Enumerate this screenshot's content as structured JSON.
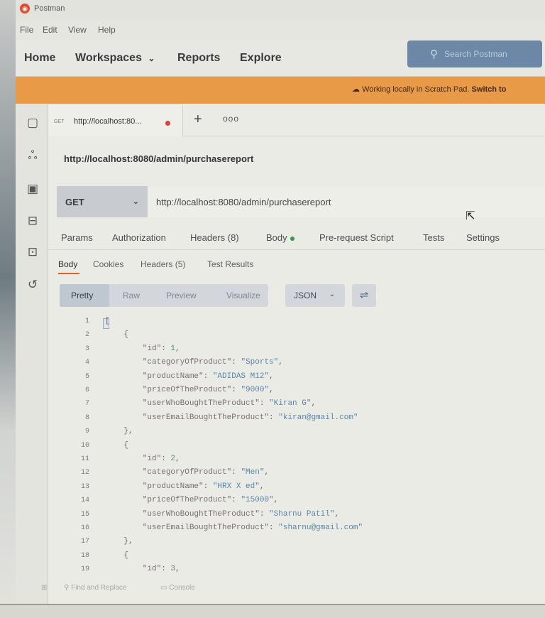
{
  "app": {
    "title": "Postman",
    "logo_glyph": "◉"
  },
  "menu": [
    "File",
    "Edit",
    "View",
    "Help"
  ],
  "nav": {
    "home": "Home",
    "workspaces": "Workspaces",
    "reports": "Reports",
    "explore": "Explore",
    "workspaces_chevron": "⌄"
  },
  "search": {
    "placeholder": "Search Postman",
    "icon": "search-icon"
  },
  "banner": {
    "icon": "cloud-off-icon",
    "text": "Working locally in Scratch Pad.",
    "link": "Switch to"
  },
  "sidebar_icons": [
    "collections-icon",
    "apis-icon",
    "environments-icon",
    "mock-servers-icon",
    "monitors-icon",
    "history-icon"
  ],
  "tab": {
    "method": "GET",
    "url": "http://localhost:80...",
    "add": "+",
    "more": "ooo"
  },
  "request": {
    "title": "http://localhost:8080/admin/purchasereport",
    "method": "GET",
    "url": "http://localhost:8080/admin/purchasereport"
  },
  "request_tabs": {
    "params": "Params",
    "authorization": "Authorization",
    "headers": "Headers (8)",
    "body": "Body",
    "prerequest": "Pre-request Script",
    "tests": "Tests",
    "settings": "Settings"
  },
  "response_tabs": {
    "body": "Body",
    "cookies": "Cookies",
    "headers": "Headers (5)",
    "test_results": "Test Results"
  },
  "format": {
    "pretty": "Pretty",
    "raw": "Raw",
    "preview": "Preview",
    "visualize": "Visualize",
    "language": "JSON"
  },
  "code_lines": [
    {
      "n": "1",
      "parts": [
        [
          "punc",
          "["
        ]
      ]
    },
    {
      "n": "2",
      "parts": [
        [
          "punc",
          "    {"
        ]
      ]
    },
    {
      "n": "3",
      "parts": [
        [
          "key",
          "        \"id\""
        ],
        [
          "punc",
          ": "
        ],
        [
          "num",
          "1"
        ],
        [
          "punc",
          ","
        ]
      ]
    },
    {
      "n": "4",
      "parts": [
        [
          "key",
          "        \"categoryOfProduct\""
        ],
        [
          "punc",
          ": "
        ],
        [
          "str",
          "\"Sports\""
        ],
        [
          "punc",
          ","
        ]
      ]
    },
    {
      "n": "5",
      "parts": [
        [
          "key",
          "        \"productName\""
        ],
        [
          "punc",
          ": "
        ],
        [
          "str",
          "\"ADIDAS M12\""
        ],
        [
          "punc",
          ","
        ]
      ]
    },
    {
      "n": "6",
      "parts": [
        [
          "key",
          "        \"priceOfTheProduct\""
        ],
        [
          "punc",
          ": "
        ],
        [
          "str",
          "\"9000\""
        ],
        [
          "punc",
          ","
        ]
      ]
    },
    {
      "n": "7",
      "parts": [
        [
          "key",
          "        \"userWhoBoughtTheProduct\""
        ],
        [
          "punc",
          ": "
        ],
        [
          "str",
          "\"Kiran G\""
        ],
        [
          "punc",
          ","
        ]
      ]
    },
    {
      "n": "8",
      "parts": [
        [
          "key",
          "        \"userEmailBoughtTheProduct\""
        ],
        [
          "punc",
          ": "
        ],
        [
          "str",
          "\"kiran@gmail.com\""
        ]
      ]
    },
    {
      "n": "9",
      "parts": [
        [
          "punc",
          "    },"
        ]
      ]
    },
    {
      "n": "10",
      "parts": [
        [
          "punc",
          "    {"
        ]
      ]
    },
    {
      "n": "11",
      "parts": [
        [
          "key",
          "        \"id\""
        ],
        [
          "punc",
          ": "
        ],
        [
          "num",
          "2"
        ],
        [
          "punc",
          ","
        ]
      ]
    },
    {
      "n": "12",
      "parts": [
        [
          "key",
          "        \"categoryOfProduct\""
        ],
        [
          "punc",
          ": "
        ],
        [
          "str",
          "\"Men\""
        ],
        [
          "punc",
          ","
        ]
      ]
    },
    {
      "n": "13",
      "parts": [
        [
          "key",
          "        \"productName\""
        ],
        [
          "punc",
          ": "
        ],
        [
          "str",
          "\"HRX X ed\""
        ],
        [
          "punc",
          ","
        ]
      ]
    },
    {
      "n": "14",
      "parts": [
        [
          "key",
          "        \"priceOfTheProduct\""
        ],
        [
          "punc",
          ": "
        ],
        [
          "str",
          "\"15000\""
        ],
        [
          "punc",
          ","
        ]
      ]
    },
    {
      "n": "15",
      "parts": [
        [
          "key",
          "        \"userWhoBoughtTheProduct\""
        ],
        [
          "punc",
          ": "
        ],
        [
          "str",
          "\"Sharnu Patil\""
        ],
        [
          "punc",
          ","
        ]
      ]
    },
    {
      "n": "16",
      "parts": [
        [
          "key",
          "        \"userEmailBoughtTheProduct\""
        ],
        [
          "punc",
          ": "
        ],
        [
          "str",
          "\"sharnu@gmail.com\""
        ]
      ]
    },
    {
      "n": "17",
      "parts": [
        [
          "punc",
          "    },"
        ]
      ]
    },
    {
      "n": "18",
      "parts": [
        [
          "punc",
          "    {"
        ]
      ]
    },
    {
      "n": "19",
      "parts": [
        [
          "key",
          "        \"id\""
        ],
        [
          "punc",
          ": "
        ],
        [
          "num",
          "3"
        ],
        [
          "punc",
          ","
        ]
      ]
    }
  ],
  "footer": {
    "find_replace": "Find and Replace",
    "console": "Console"
  }
}
